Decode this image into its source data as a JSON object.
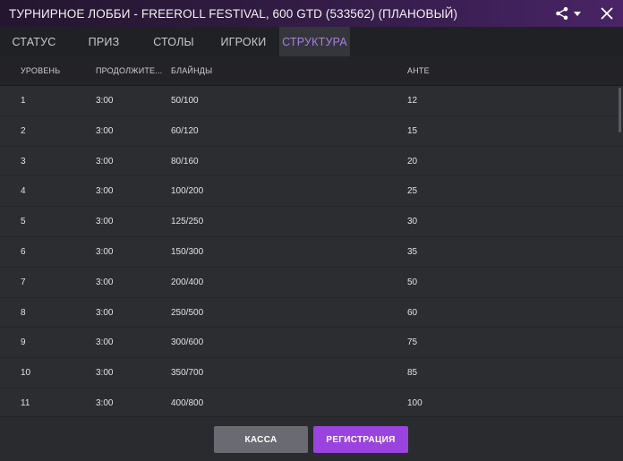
{
  "window": {
    "title": "ТУРНИРНОЕ ЛОББИ - FREEROLL FESTIVAL, 600 GTD (533562) (ПЛАНОВЫЙ)",
    "icons": {
      "share": "share-icon",
      "dropdown": "chevron-down-icon",
      "close": "close-icon"
    }
  },
  "tabs": [
    {
      "label": "СТАТУС"
    },
    {
      "label": "ПРИЗ"
    },
    {
      "label": "СТОЛЫ"
    },
    {
      "label": "ИГРОКИ"
    },
    {
      "label": "СТРУКТУРА",
      "active": true
    }
  ],
  "table": {
    "headers": {
      "level": "УРОВЕНЬ",
      "duration": "ПРОДОЛЖИТЕ...",
      "blinds": "БЛАЙНДЫ",
      "ante": "АНТЕ"
    },
    "rows": [
      {
        "level": "1",
        "duration": "3:00",
        "blinds": "50/100",
        "ante": "12"
      },
      {
        "level": "2",
        "duration": "3:00",
        "blinds": "60/120",
        "ante": "15"
      },
      {
        "level": "3",
        "duration": "3:00",
        "blinds": "80/160",
        "ante": "20"
      },
      {
        "level": "4",
        "duration": "3:00",
        "blinds": "100/200",
        "ante": "25"
      },
      {
        "level": "5",
        "duration": "3:00",
        "blinds": "125/250",
        "ante": "30"
      },
      {
        "level": "6",
        "duration": "3:00",
        "blinds": "150/300",
        "ante": "35"
      },
      {
        "level": "7",
        "duration": "3:00",
        "blinds": "200/400",
        "ante": "50"
      },
      {
        "level": "8",
        "duration": "3:00",
        "blinds": "250/500",
        "ante": "60"
      },
      {
        "level": "9",
        "duration": "3:00",
        "blinds": "300/600",
        "ante": "75"
      },
      {
        "level": "10",
        "duration": "3:00",
        "blinds": "350/700",
        "ante": "85"
      },
      {
        "level": "11",
        "duration": "3:00",
        "blinds": "400/800",
        "ante": "100"
      }
    ]
  },
  "footer": {
    "cashier_label": "КАССА",
    "register_label": "РЕГИСТРАЦИЯ"
  },
  "colors": {
    "accent": "#9a43de",
    "active_tab_text": "#a77ee6",
    "cashier_button": "#6a6b72",
    "background": "#2c2d31"
  }
}
